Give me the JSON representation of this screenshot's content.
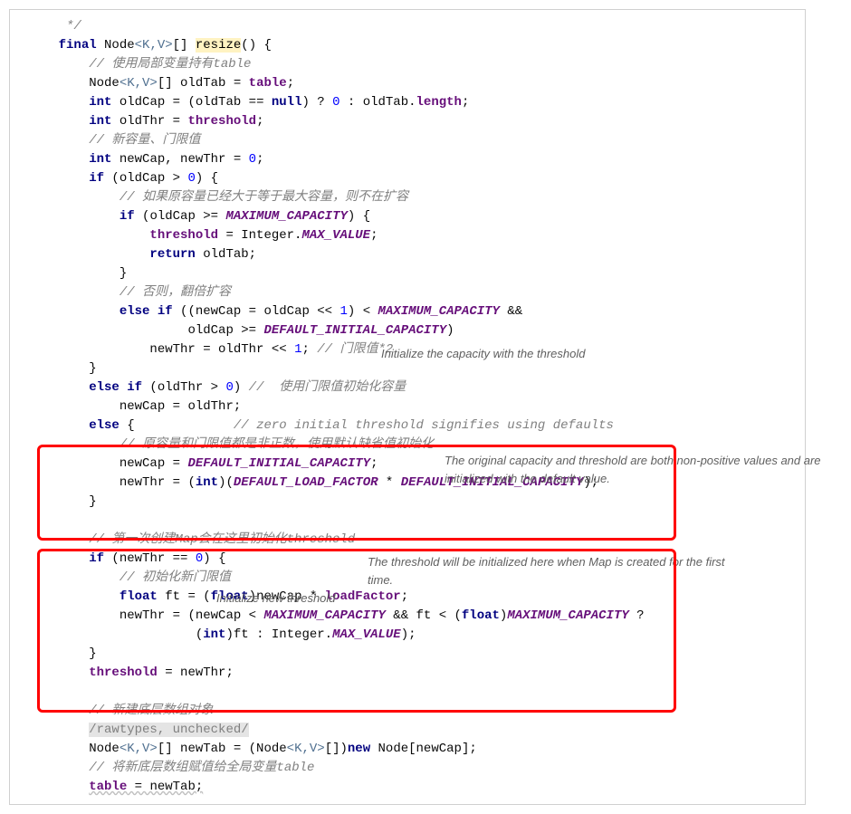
{
  "code": {
    "l0": "*/",
    "l1_final": "final",
    "l1_node": "Node",
    "l1_gen": "<K,V>",
    "l1_arr": "[] ",
    "l1_method": "resize",
    "l1_rest": "() {",
    "l2": "// 使用局部变量持有table",
    "l3_a": "Node",
    "l3_b": "<K,V>",
    "l3_c": "[] oldTab = ",
    "l3_d": "table",
    "l3_e": ";",
    "l4_a": "int",
    "l4_b": " oldCap = (oldTab == ",
    "l4_c": "null",
    "l4_d": ") ? ",
    "l4_e": "0",
    "l4_f": " : oldTab.",
    "l4_g": "length",
    "l4_h": ";",
    "l5_a": "int",
    "l5_b": " oldThr = ",
    "l5_c": "threshold",
    "l5_d": ";",
    "l6": "// 新容量、门限值",
    "l7_a": "int",
    "l7_b": " newCap, newThr = ",
    "l7_c": "0",
    "l7_d": ";",
    "l8_a": "if",
    "l8_b": " (oldCap > ",
    "l8_c": "0",
    "l8_d": ") {",
    "l9": "// 如果原容量已经大于等于最大容量，则不在扩容",
    "l10_a": "if",
    "l10_b": " (oldCap >= ",
    "l10_c": "MAXIMUM_CAPACITY",
    "l10_d": ") {",
    "l11_a": "threshold",
    "l11_b": " = Integer.",
    "l11_c": "MAX_VALUE",
    "l11_d": ";",
    "l12_a": "return",
    "l12_b": " oldTab;",
    "l13": "}",
    "l14": "// 否则，翻倍扩容",
    "l15_a": "else if",
    "l15_b": " ((newCap = oldCap << ",
    "l15_c": "1",
    "l15_d": ") < ",
    "l15_e": "MAXIMUM_CAPACITY",
    "l15_f": " &&",
    "l16_a": "         oldCap >= ",
    "l16_b": "DEFAULT_INITIAL_CAPACITY",
    "l16_c": ")",
    "l17_a": "newThr = oldThr << ",
    "l17_b": "1",
    "l17_c": "; ",
    "l17_d": "// 门限值*2",
    "l18": "}",
    "l19_a": "else if",
    "l19_b": " (oldThr > ",
    "l19_c": "0",
    "l19_d": ") ",
    "l19_e": "//  使用门限值初始化容量",
    "l20": "newCap = oldThr;",
    "l21_a": "else",
    "l21_b": " {",
    "l21_x": "             ",
    "l21_c": "// zero initial threshold signifies using defaults",
    "l22": "// 原容量和门限值都是非正数，使用默认缺省值初始化",
    "l23_a": "newCap = ",
    "l23_b": "DEFAULT_INITIAL_CAPACITY",
    "l23_c": ";",
    "l24_a": "newThr = (",
    "l24_b": "int",
    "l24_c": ")(",
    "l24_d": "DEFAULT_LOAD_FACTOR",
    "l24_e": " * ",
    "l24_f": "DEFAULT_INITIAL_CAPACITY",
    "l24_g": ");",
    "l25": "}",
    "l26_blank": "",
    "l27": "// 第一次创建Map会在这里初始化threshold",
    "l28_a": "if",
    "l28_b": " (newThr == ",
    "l28_c": "0",
    "l28_d": ") {",
    "l29": "// 初始化新门限值",
    "l30_a": "float",
    "l30_b": " ft = (",
    "l30_c": "float",
    "l30_d": ")newCap * ",
    "l30_e": "loadFactor",
    "l30_f": ";",
    "l31_a": "newThr = (newCap < ",
    "l31_b": "MAXIMUM_CAPACITY",
    "l31_c": " && ft < (",
    "l31_d": "float",
    "l31_e": ")",
    "l31_f": "MAXIMUM_CAPACITY",
    "l31_g": " ?",
    "l32_a": "          (",
    "l32_b": "int",
    "l32_c": ")ft : Integer.",
    "l32_d": "MAX_VALUE",
    "l32_e": ");",
    "l33": "}",
    "l34_a": "threshold",
    "l34_b": " = newThr;",
    "l35_blank": "",
    "l36": "// 新建底层数组对象",
    "l37": "/rawtypes, unchecked/",
    "l38_a": "Node",
    "l38_b": "<K,V>",
    "l38_c": "[] newTab = (Node",
    "l38_d": "<K,V>",
    "l38_e": "[])",
    "l38_f": "new",
    "l38_g": " Node[newCap];",
    "l39": "// 将新底层数组赋值给全局变量table",
    "l40_a": "table",
    "l40_b": " = newTab;"
  },
  "annotations": {
    "a1": "Initialize the capacity with the threshold",
    "a2": "The original capacity and threshold are both non-positive values and are initialized with the default value.",
    "a3": "The threshold will be initialized here when Map is created for the first time.",
    "a4": "Initialize new threshold"
  }
}
